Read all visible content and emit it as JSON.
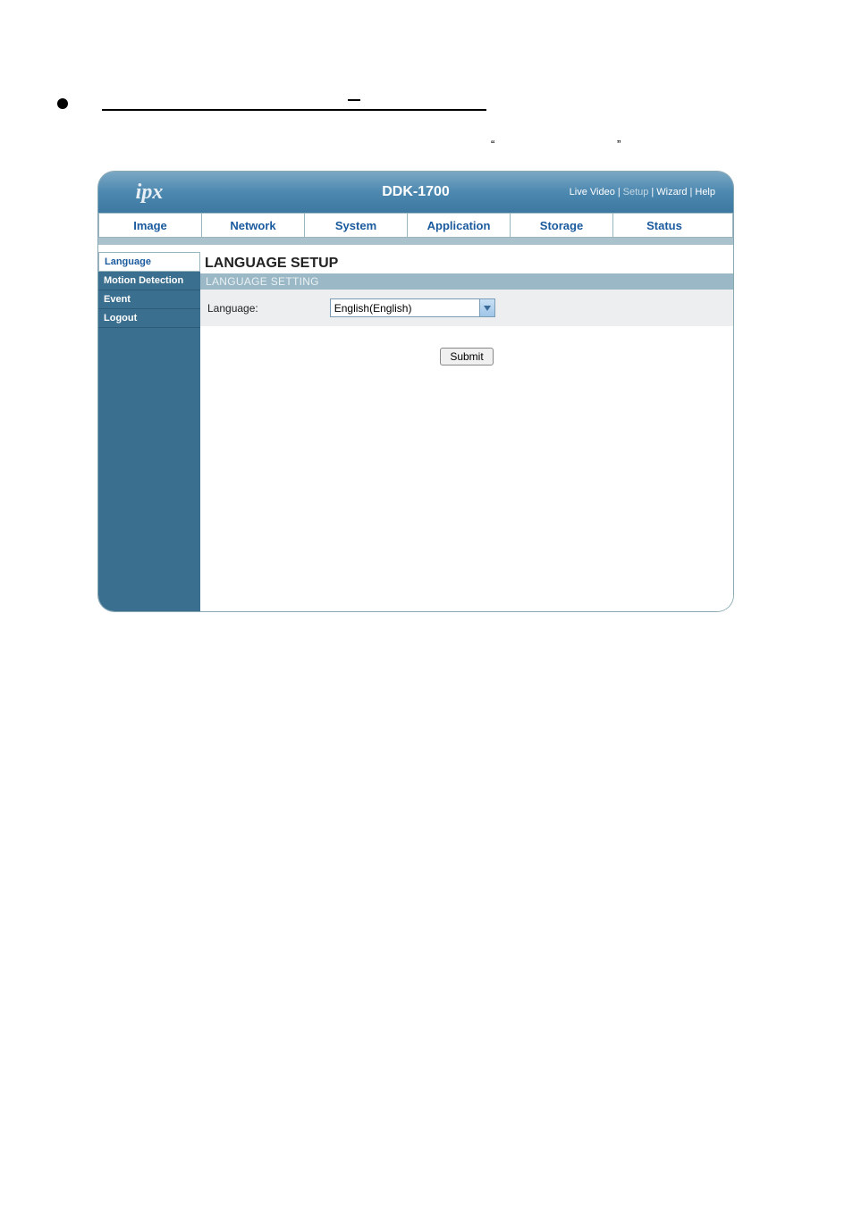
{
  "document": {
    "quote_left": "“",
    "quote_right": "”"
  },
  "header": {
    "logo_text": "ipx",
    "model": "DDK-1700",
    "links": {
      "live_video": "Live Video",
      "setup": "Setup",
      "wizard": "Wizard",
      "help": "Help"
    }
  },
  "tabs": [
    "Image",
    "Network",
    "System",
    "Application",
    "Storage",
    "Status"
  ],
  "sidebar": {
    "items": [
      {
        "label": "Language",
        "active": true
      },
      {
        "label": "Motion Detection",
        "active": false
      },
      {
        "label": "Event",
        "active": false
      },
      {
        "label": "Logout",
        "active": false
      }
    ]
  },
  "main": {
    "title": "LANGUAGE SETUP",
    "section": "LANGUAGE SETTING",
    "form": {
      "language_label": "Language:",
      "language_value": "English(English)"
    },
    "submit_label": "Submit"
  }
}
